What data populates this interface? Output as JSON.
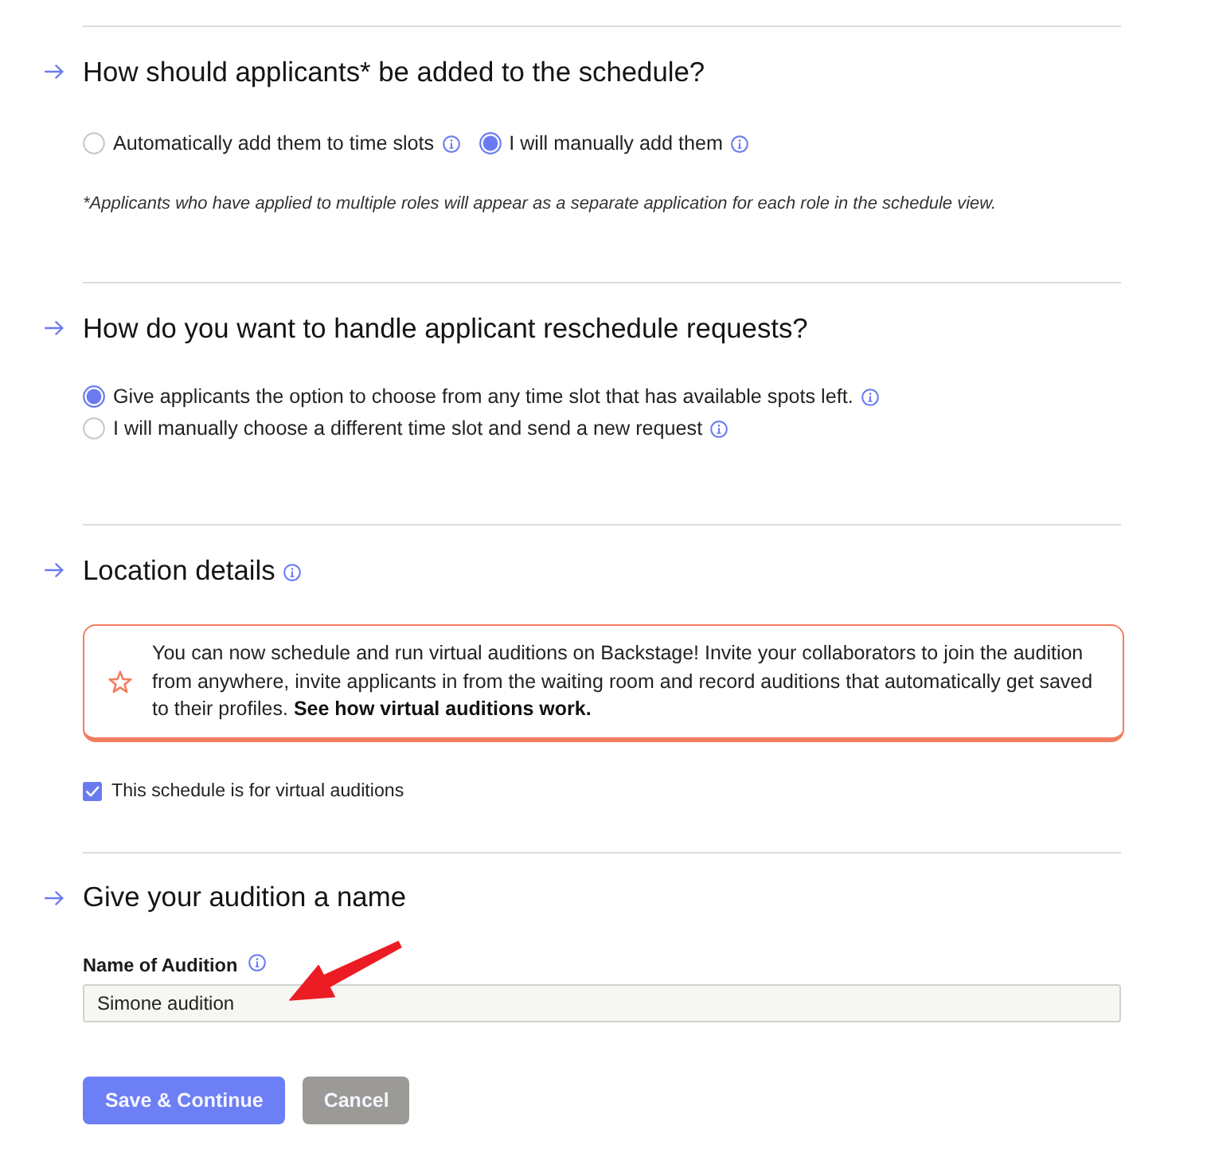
{
  "sections": [
    {
      "kind": "radio_inline",
      "title": "How should applicants* be added to the schedule?",
      "info": false,
      "options": [
        {
          "label": "Automatically add them to time slots",
          "selected": false,
          "info": true
        },
        {
          "label": "I will manually add them",
          "selected": true,
          "info": true
        }
      ],
      "note": "*Applicants who have applied to multiple roles will appear as a separate application for each role in the schedule view."
    },
    {
      "kind": "radio_stacked",
      "title": "How do you want to handle applicant reschedule requests?",
      "info": false,
      "options": [
        {
          "label": "Give applicants the option to choose from any time slot that has available spots left.",
          "selected": true,
          "info": true
        },
        {
          "label": "I will manually choose a different time slot and send a new request",
          "selected": false,
          "info": true
        }
      ]
    },
    {
      "kind": "location",
      "title": "Location details",
      "info": true,
      "callout": {
        "text": "You can now schedule and run virtual auditions on Backstage! Invite your collaborators to join the audition from anywhere, invite applicants in from the waiting room and record auditions that automatically get saved to their profiles.",
        "link": "See how virtual auditions work."
      },
      "checkbox": {
        "label": "This schedule is for virtual auditions",
        "checked": true
      }
    },
    {
      "kind": "name",
      "title": "Give your audition a name",
      "info": false,
      "field": {
        "label": "Name of Audition",
        "info": true,
        "value": "Simone audition"
      }
    }
  ],
  "buttons": [
    {
      "label": "Save & Continue",
      "kind": "primary"
    },
    {
      "label": "Cancel",
      "kind": "secondary"
    }
  ]
}
